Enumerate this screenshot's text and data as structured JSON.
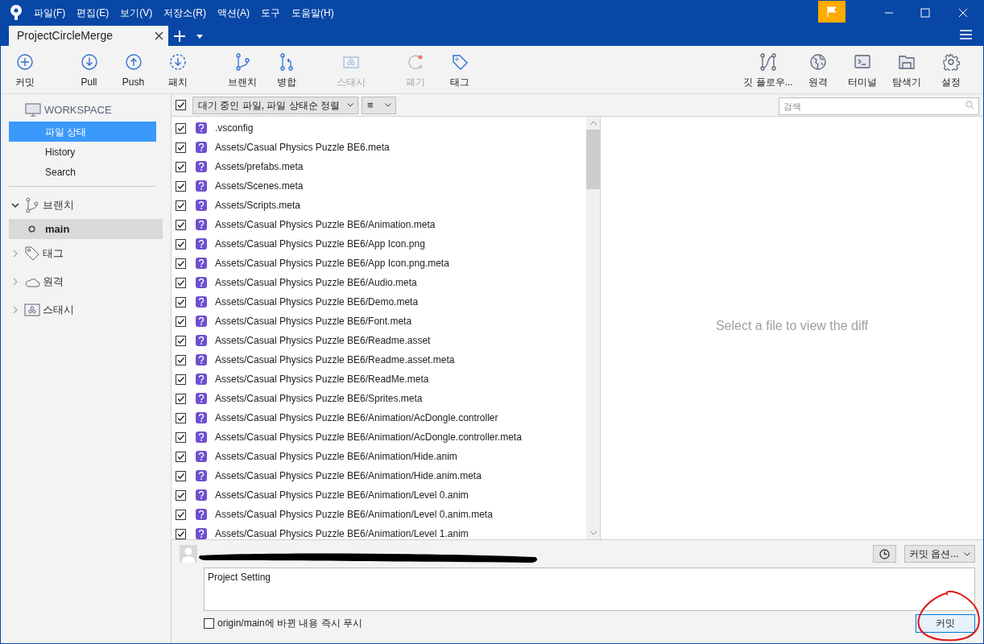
{
  "menu": [
    "파일(F)",
    "편집(E)",
    "보기(V)",
    "저장소(R)",
    "액션(A)",
    "도구",
    "도움말(H)"
  ],
  "tabs": [
    {
      "label": "ProjectCircleMerge",
      "selected": true
    }
  ],
  "toolbar_left": [
    {
      "label": "커밋",
      "disabled": false
    },
    {
      "label": "Pull",
      "disabled": false
    },
    {
      "label": "Push",
      "disabled": false
    },
    {
      "label": "패치",
      "disabled": false
    },
    {
      "label": "브랜치",
      "disabled": false
    },
    {
      "label": "병합",
      "disabled": false
    },
    {
      "label": "스태시",
      "disabled": true
    },
    {
      "label": "폐기",
      "disabled": true
    },
    {
      "label": "태그",
      "disabled": false
    }
  ],
  "toolbar_right": [
    {
      "label": "깃 플로우..."
    },
    {
      "label": "원격"
    },
    {
      "label": "터미널"
    },
    {
      "label": "탐색기"
    },
    {
      "label": "설정"
    }
  ],
  "sidebar": {
    "workspace": {
      "title": "WORKSPACE",
      "items": [
        {
          "label": "파일 상태",
          "selected": true
        },
        {
          "label": "History",
          "selected": false
        },
        {
          "label": "Search",
          "selected": false
        }
      ]
    },
    "groups": [
      {
        "label": "브랜치",
        "expanded": true,
        "children": [
          {
            "label": "main",
            "selected": true
          }
        ]
      },
      {
        "label": "태그",
        "expanded": false
      },
      {
        "label": "원격",
        "expanded": false
      },
      {
        "label": "스태시",
        "expanded": false
      }
    ]
  },
  "filter": {
    "all_checked": true,
    "sort": "대기 중인 파일, 파일 상태순 정렬",
    "view": "≡",
    "search_placeholder": "검색"
  },
  "files": [
    {
      "path": ".vsconfig",
      "checked": true
    },
    {
      "path": "Assets/Casual Physics Puzzle BE6.meta",
      "checked": true
    },
    {
      "path": "Assets/prefabs.meta",
      "checked": true
    },
    {
      "path": "Assets/Scenes.meta",
      "checked": true
    },
    {
      "path": "Assets/Scripts.meta",
      "checked": true
    },
    {
      "path": "Assets/Casual Physics Puzzle BE6/Animation.meta",
      "checked": true
    },
    {
      "path": "Assets/Casual Physics Puzzle BE6/App Icon.png",
      "checked": true
    },
    {
      "path": "Assets/Casual Physics Puzzle BE6/App Icon.png.meta",
      "checked": true
    },
    {
      "path": "Assets/Casual Physics Puzzle BE6/Audio.meta",
      "checked": true
    },
    {
      "path": "Assets/Casual Physics Puzzle BE6/Demo.meta",
      "checked": true
    },
    {
      "path": "Assets/Casual Physics Puzzle BE6/Font.meta",
      "checked": true
    },
    {
      "path": "Assets/Casual Physics Puzzle BE6/Readme.asset",
      "checked": true
    },
    {
      "path": "Assets/Casual Physics Puzzle BE6/Readme.asset.meta",
      "checked": true
    },
    {
      "path": "Assets/Casual Physics Puzzle BE6/ReadMe.meta",
      "checked": true
    },
    {
      "path": "Assets/Casual Physics Puzzle BE6/Sprites.meta",
      "checked": true
    },
    {
      "path": "Assets/Casual Physics Puzzle BE6/Animation/AcDongle.controller",
      "checked": true
    },
    {
      "path": "Assets/Casual Physics Puzzle BE6/Animation/AcDongle.controller.meta",
      "checked": true
    },
    {
      "path": "Assets/Casual Physics Puzzle BE6/Animation/Hide.anim",
      "checked": true
    },
    {
      "path": "Assets/Casual Physics Puzzle BE6/Animation/Hide.anim.meta",
      "checked": true
    },
    {
      "path": "Assets/Casual Physics Puzzle BE6/Animation/Level 0.anim",
      "checked": true
    },
    {
      "path": "Assets/Casual Physics Puzzle BE6/Animation/Level 0.anim.meta",
      "checked": true
    },
    {
      "path": "Assets/Casual Physics Puzzle BE6/Animation/Level 1.anim",
      "checked": true
    }
  ],
  "diff": {
    "empty_text": "Select a file to view the diff"
  },
  "commit": {
    "options": "커밋 옵션...",
    "message": "Project Setting",
    "push_now": {
      "label": "origin/main에 바뀐 내용 즉시 푸시",
      "checked": false
    },
    "button": "커밋"
  }
}
